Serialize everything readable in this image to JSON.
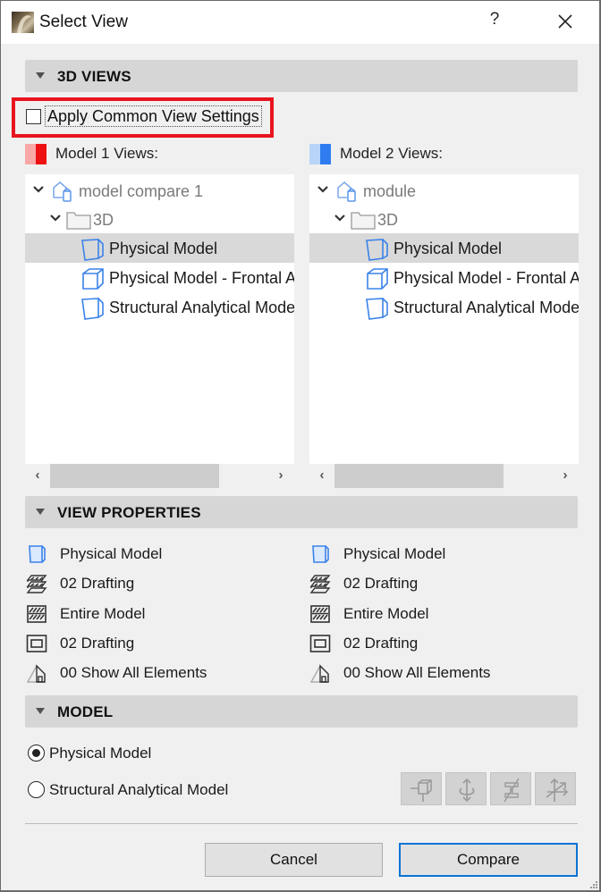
{
  "window": {
    "title": "Select View",
    "help_label": "?",
    "icons": {
      "app": "archicad-app-icon",
      "help": "help-icon",
      "close": "close-icon"
    }
  },
  "sections": {
    "views": {
      "label": "3D VIEWS",
      "expanded": true
    },
    "properties": {
      "label": "VIEW PROPERTIES",
      "expanded": true
    },
    "model": {
      "label": "MODEL",
      "expanded": true
    }
  },
  "apply_common": {
    "label": "Apply Common View Settings",
    "checked": false,
    "highlight_color": "#e8141e"
  },
  "model1": {
    "label": "Model 1 Views:",
    "swatch_colors": [
      "#f9a8a8",
      "#ee1111"
    ],
    "tree": [
      {
        "label": "model compare 1",
        "icon": "project-icon",
        "level": 0,
        "expanded": true,
        "selected": false
      },
      {
        "label": "3D",
        "icon": "folder-icon",
        "level": 1,
        "expanded": true,
        "selected": false
      },
      {
        "label": "Physical Model",
        "icon": "view-3d-icon",
        "level": 2,
        "selected": true
      },
      {
        "label": "Physical Model - Frontal A",
        "icon": "cube-icon",
        "level": 2,
        "selected": false
      },
      {
        "label": "Structural Analytical Mode",
        "icon": "view-3d-icon",
        "level": 2,
        "selected": false
      }
    ]
  },
  "model2": {
    "label": "Model 2 Views:",
    "swatch_colors": [
      "#b8d4f8",
      "#2e7cf0"
    ],
    "tree": [
      {
        "label": "module",
        "icon": "project-icon",
        "level": 0,
        "expanded": true,
        "selected": false
      },
      {
        "label": "3D",
        "icon": "folder-icon",
        "level": 1,
        "expanded": true,
        "selected": false
      },
      {
        "label": "Physical Model",
        "icon": "view-3d-icon",
        "level": 2,
        "selected": true
      },
      {
        "label": "Physical Model - Frontal A",
        "icon": "cube-icon",
        "level": 2,
        "selected": false
      },
      {
        "label": "Structural Analytical Mode",
        "icon": "view-3d-icon",
        "level": 2,
        "selected": false
      }
    ]
  },
  "scroll": {
    "left_arrow": "‹",
    "right_arrow": "›"
  },
  "properties": {
    "left": [
      {
        "icon": "model-view-icon",
        "label": "Physical Model"
      },
      {
        "icon": "layers-icon",
        "label": "02 Drafting"
      },
      {
        "icon": "marquee-hatch-icon",
        "label": "Entire Model"
      },
      {
        "icon": "scale-frame-icon",
        "label": "02 Drafting"
      },
      {
        "icon": "renovation-house-icon",
        "label": "00 Show All Elements"
      }
    ],
    "right": [
      {
        "icon": "model-view-icon",
        "label": "Physical Model"
      },
      {
        "icon": "layers-icon",
        "label": "02 Drafting"
      },
      {
        "icon": "marquee-hatch-icon",
        "label": "Entire Model"
      },
      {
        "icon": "scale-frame-icon",
        "label": "02 Drafting"
      },
      {
        "icon": "renovation-house-icon",
        "label": "00 Show All Elements"
      }
    ]
  },
  "model_options": {
    "selected": "Physical Model",
    "options": [
      "Physical Model",
      "Structural Analytical Model"
    ],
    "tools": [
      "analytical-member-icon",
      "support-rotation-icon",
      "cross-section-icon",
      "axis-arrows-icon"
    ],
    "tools_enabled": false
  },
  "buttons": {
    "cancel": "Cancel",
    "compare": "Compare"
  }
}
